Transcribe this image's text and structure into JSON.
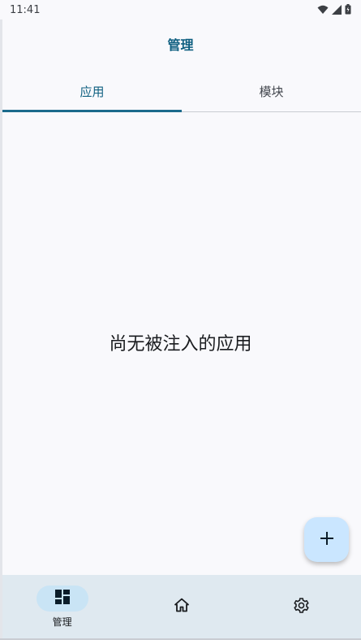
{
  "status_bar": {
    "time": "11:41",
    "icons": [
      "wifi-icon",
      "cellular-signal-icon",
      "battery-charging-icon"
    ]
  },
  "top_bar": {
    "title": "管理"
  },
  "tabs": [
    {
      "label": "应用",
      "active": true
    },
    {
      "label": "模块",
      "active": false
    }
  ],
  "empty_state": {
    "message": "尚无被注入的应用"
  },
  "fab": {
    "icon": "add-icon"
  },
  "bottom_nav": {
    "items": [
      {
        "label": "管理",
        "icon": "dashboard-icon",
        "active": true
      },
      {
        "label": "",
        "icon": "home-icon",
        "active": false
      },
      {
        "label": "",
        "icon": "settings-icon",
        "active": false
      }
    ]
  },
  "colors": {
    "accent": "#0e5f80",
    "background": "#f9f9fc",
    "nav_background": "#dfe9f0",
    "fab_background": "#cae6ff"
  }
}
